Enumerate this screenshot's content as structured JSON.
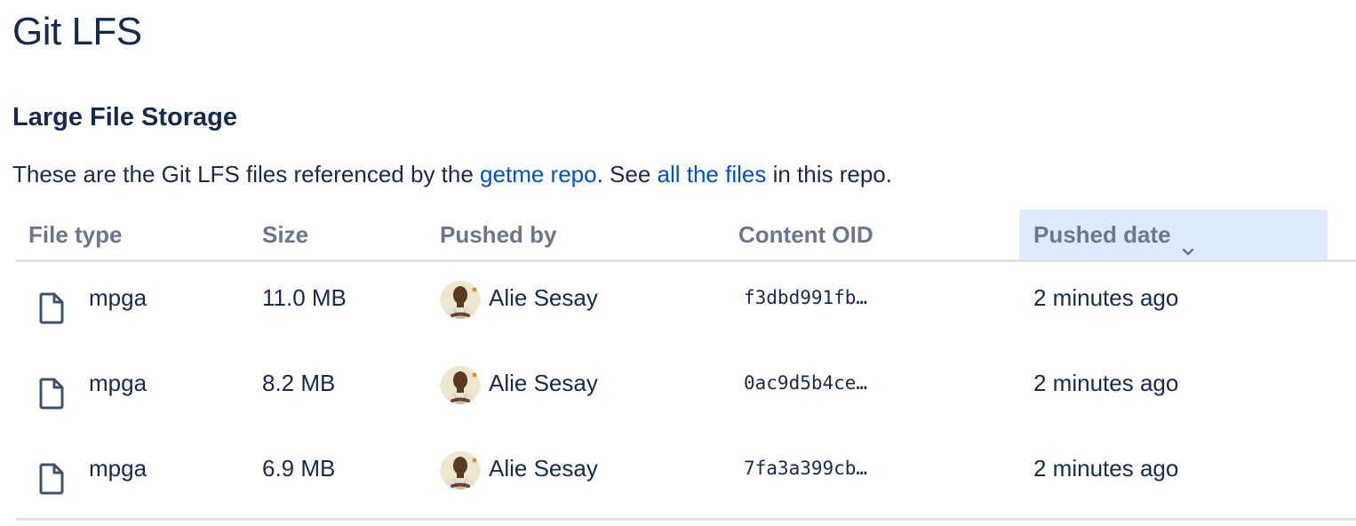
{
  "page": {
    "title": "Git LFS"
  },
  "section": {
    "title": "Large File Storage",
    "description": {
      "prefix": "These are the Git LFS files referenced by the ",
      "repo_link": "getme repo",
      "middle": ". See ",
      "files_link": "all the files",
      "suffix": " in this repo."
    }
  },
  "table": {
    "columns": {
      "file_type": "File type",
      "size": "Size",
      "pushed_by": "Pushed by",
      "content_oid": "Content OID",
      "pushed_date": "Pushed date"
    },
    "sorted_column": "pushed_date",
    "sort_direction": "descending",
    "rows": [
      {
        "file_icon": "file-icon",
        "file_type": "mpga",
        "size": "11.0 MB",
        "avatar": "user-avatar",
        "pushed_by": "Alie Sesay",
        "content_oid": "f3dbd991fb…",
        "pushed_date": "2 minutes ago"
      },
      {
        "file_icon": "file-icon",
        "file_type": "mpga",
        "size": "8.2 MB",
        "avatar": "user-avatar",
        "pushed_by": "Alie Sesay",
        "content_oid": "0ac9d5b4ce…",
        "pushed_date": "2 minutes ago"
      },
      {
        "file_icon": "file-icon",
        "file_type": "mpga",
        "size": "6.9 MB",
        "avatar": "user-avatar",
        "pushed_by": "Alie Sesay",
        "content_oid": "7fa3a399cb…",
        "pushed_date": "2 minutes ago"
      }
    ]
  },
  "colors": {
    "text": "#172b4d",
    "link": "#0052cc",
    "header_text": "#6b778c",
    "sorted_header_bg": "#deebff",
    "divider": "#dfe1e6"
  }
}
